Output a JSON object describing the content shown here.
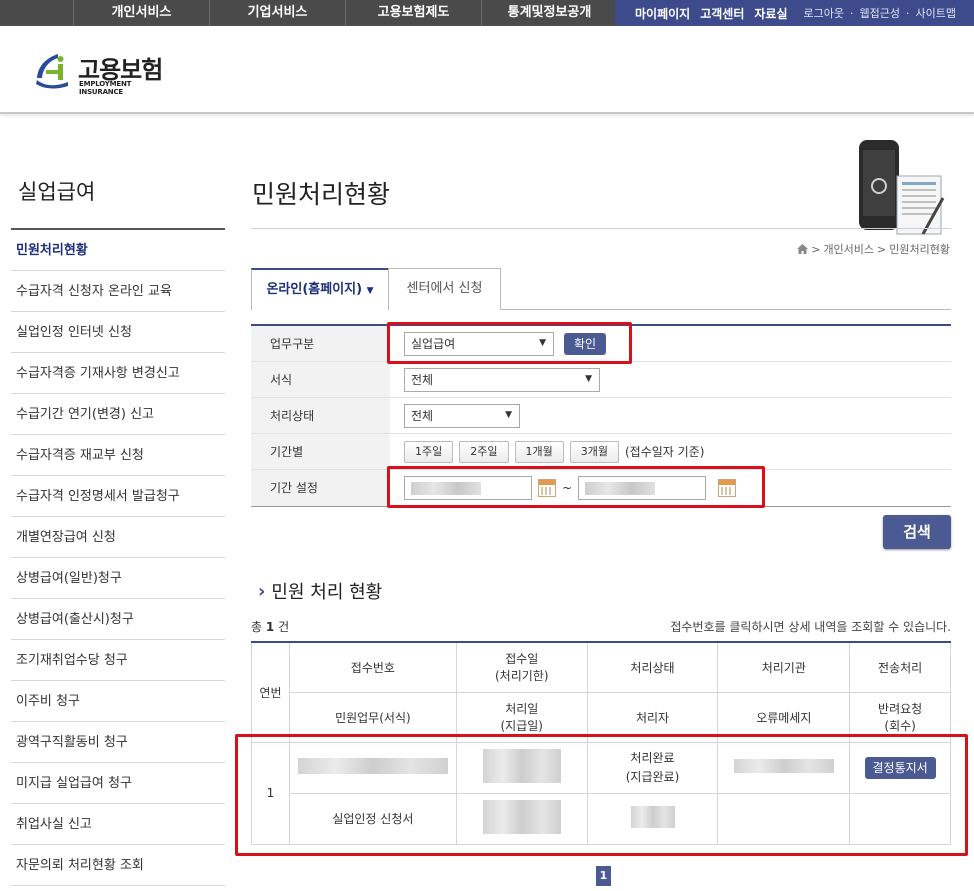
{
  "topnav": {
    "main_items": [
      "개인서비스",
      "기업서비스",
      "고용보험제도",
      "통계및정보공개"
    ],
    "util_items": [
      "마이페이지",
      "고객센터",
      "자료실"
    ],
    "util_links": [
      "로그아웃",
      "웹접근성",
      "사이트맵"
    ]
  },
  "logo": {
    "ko": "고용보험",
    "en": "EMPLOYMENT INSURANCE"
  },
  "sidebar": {
    "title": "실업급여",
    "items": [
      "민원처리현황",
      "수급자격 신청자 온라인 교육",
      "실업인정 인터넷 신청",
      "수급자격증 기재사항 변경신고",
      "수급기간 연기(변경) 신고",
      "수급자격증 재교부 신청",
      "수급자격 인정명세서 발급청구",
      "개별연장급여 신청",
      "상병급여(일반)청구",
      "상병급여(출산시)청구",
      "조기재취업수당 청구",
      "이주비 청구",
      "광역구직활동비 청구",
      "미지급 실업급여 청구",
      "취업사실 신고",
      "자문의뢰 처리현황 조회"
    ]
  },
  "main": {
    "title": "민원처리현황",
    "breadcrumb": [
      "개인서비스",
      "민원처리현황"
    ],
    "tabs": [
      "온라인(홈페이지)",
      "센터에서 신청"
    ]
  },
  "filter": {
    "rows": [
      {
        "label": "업무구분"
      },
      {
        "label": "서식"
      },
      {
        "label": "처리상태"
      },
      {
        "label": "기간별"
      },
      {
        "label": "기간 설정"
      }
    ],
    "business_select": "실업급여",
    "confirm_label": "확인",
    "form_select": "전체",
    "status_select": "전체",
    "period_buttons": [
      "1주일",
      "2주일",
      "1개월",
      "3개월"
    ],
    "period_note": "(접수일자 기준)",
    "date_sep": "~",
    "search_label": "검색"
  },
  "results": {
    "section_title": "민원 처리 현황",
    "total_prefix": "총",
    "total_count": "1",
    "total_suffix": "건",
    "hint": "접수번호를 클릭하시면 상세 내역을 조회할 수 있습니다.",
    "headers_row1": [
      "연번",
      "접수번호",
      "접수일\n(처리기한)",
      "처리상태",
      "처리기관",
      "전송처리"
    ],
    "headers_row2": [
      "민원업무(서식)",
      "처리일\n(지급일)",
      "처리자",
      "오류메세지",
      "반려요청\n(회수)"
    ],
    "rows": [
      {
        "no": "1",
        "status": "처리완료\n(지급완료)",
        "decision_button": "결정통지서",
        "form_name": "실업인정 신청서"
      }
    ]
  },
  "pager": {
    "current": "1"
  },
  "colors": {
    "accent": "#3d4b8c",
    "button": "#4c5a94",
    "highlight": "#d9101b"
  }
}
